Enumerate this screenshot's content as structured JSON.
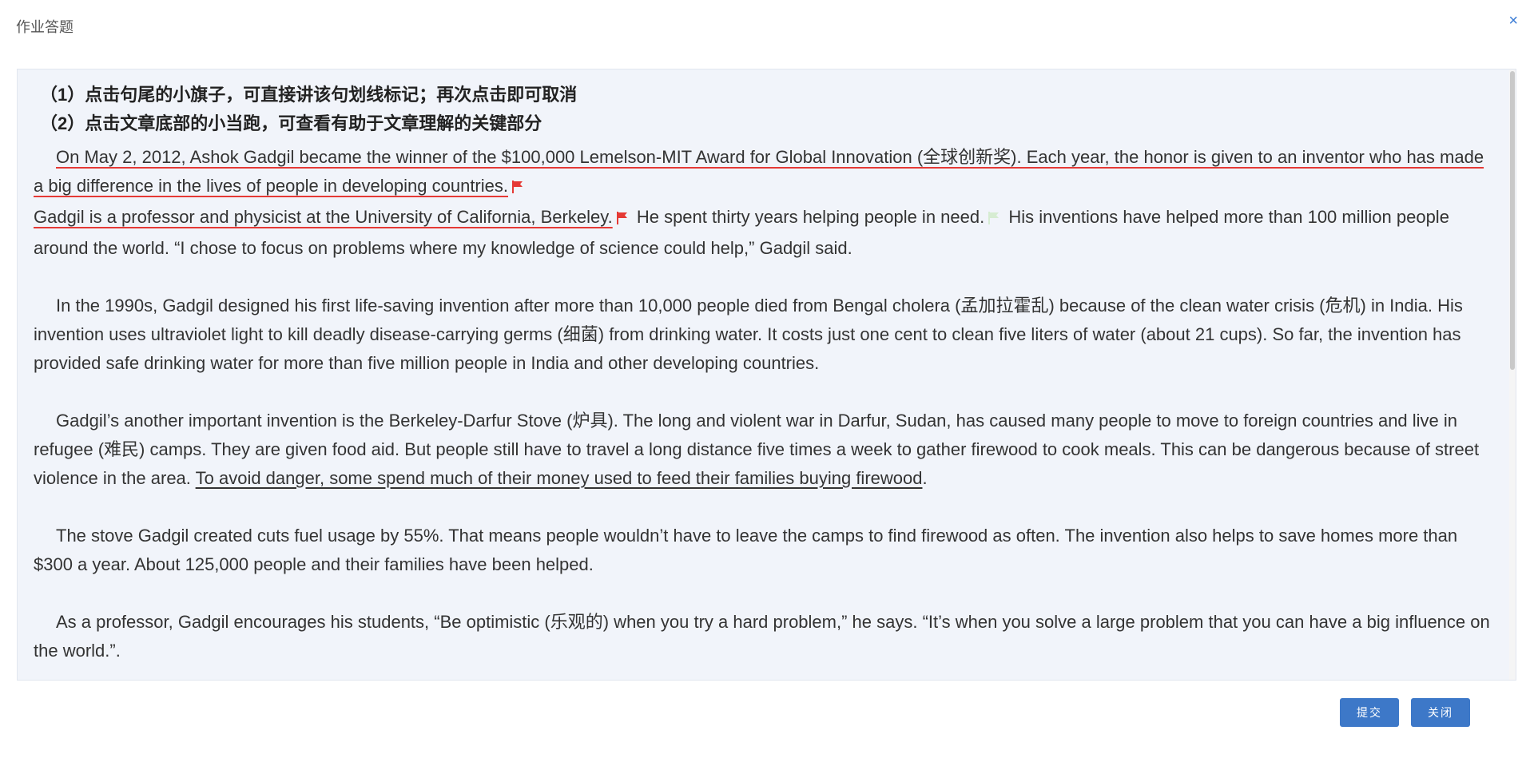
{
  "dialog": {
    "title": "作业答题",
    "close_symbol": "×"
  },
  "instructions": [
    "（1）点击句尾的小旗子，可直接讲该句划线标记；再次点击即可取消",
    "（2）点击文章底部的小当跑，可查看有助于文章理解的关键部分"
  ],
  "article": {
    "p1_s1": "On May 2, 2012, Ashok Gadgil became the winner of the $100,000 Lemelson-MIT Award for Global Innovation (全球创新奖). Each year, the honor is given to an inventor who has made a big difference in the lives of people in developing countries.",
    "p1_s2": "Gadgil is a professor and physicist at the University of California, Berkeley.",
    "p1_s3": "He spent thirty years helping people in need.",
    "p1_s4": "His inventions have helped more than 100 million people around the world. “I chose to focus on problems where my knowledge of science could help,” Gadgil said.",
    "p2": "In the 1990s, Gadgil designed his first life-saving invention after more than 10,000 people died from Bengal cholera (孟加拉霍乱) because of the clean water crisis (危机) in India. His invention uses ultraviolet light to kill deadly disease-carrying germs (细菌) from drinking water. It costs just one cent to clean five liters of water (about 21 cups). So far, the invention has provided safe drinking water for more than five million people in India and other developing countries.",
    "p3_text": "Gadgil’s another important invention is the Berkeley-Darfur Stove (炉具). The long and violent war in Darfur, Sudan, has caused many people to move to foreign countries and live in refugee (难民) camps. They are given food aid. But people still have to travel a long distance five times a week to gather firewood to cook meals. This can be dangerous because of street violence in the area.",
    "p3_key": "To avoid danger, some spend much of their money used to feed their families buying firewood",
    "p3_end": ".",
    "p4": "The stove Gadgil created cuts fuel usage by 55%. That means people wouldn’t have to leave the camps to find firewood as often. The invention also helps to save homes more than $300 a year. About 125,000 people and their families have been helped.",
    "p5": "As a professor, Gadgil encourages his students, “Be optimistic (乐观的) when you try a hard problem,” he says. “It’s when you solve a large problem that you can have a big influence on the world.”."
  },
  "buttons": {
    "submit": "提交",
    "close": "关闭"
  },
  "colors": {
    "accent": "#3d78c8",
    "mark_red": "#e53935",
    "panel_bg": "#f1f4fa"
  }
}
